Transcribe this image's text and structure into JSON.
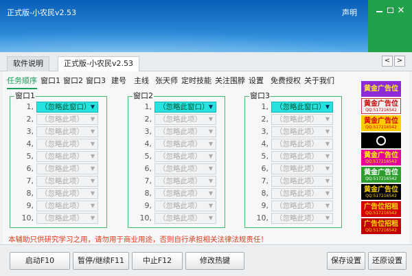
{
  "window": {
    "title": "正式版-小农民v2.53",
    "statement": "声明"
  },
  "top_tabs": [
    {
      "label": "软件说明"
    },
    {
      "label": "正式版-小农民v2.53"
    }
  ],
  "nav": {
    "prev": "<",
    "next": ">"
  },
  "sub_tabs": [
    {
      "label": "任务顺序"
    },
    {
      "label": "窗口1"
    },
    {
      "label": "窗口2"
    },
    {
      "label": "窗口3"
    },
    {
      "label": "建号"
    },
    {
      "label": "主线"
    },
    {
      "label": "张天师"
    },
    {
      "label": "定时技能"
    },
    {
      "label": "关注围脖"
    },
    {
      "label": "设置"
    },
    {
      "label": "免费授权"
    },
    {
      "label": "关于我们"
    }
  ],
  "groups": [
    {
      "title": "窗口1",
      "first": "（忽略此窗口）",
      "other": "（忽略此项）"
    },
    {
      "title": "窗口2",
      "first": "（忽略此窗口）",
      "other": "（忽略此项）"
    },
    {
      "title": "窗口3",
      "first": "（忽略此窗口）",
      "other": "（忽略此项）"
    }
  ],
  "row_numbers": [
    "1,",
    "2,",
    "3,",
    "4,",
    "5,",
    "6,",
    "7,",
    "8,",
    "9,",
    "10,"
  ],
  "warning": "本辅助只供研究学习之用，请勿用于商业用途，否则自行承担相关法律法规责任！",
  "ads": [
    {
      "text": "黄金广告位",
      "sub": ""
    },
    {
      "text": "黄金广告位",
      "sub": "QQ:517216542"
    },
    {
      "text": "黄金广告位",
      "sub": "QQ:517216542"
    },
    {
      "text": "",
      "sub": ""
    },
    {
      "text": "黄金广告位",
      "sub": "QQ:517216542"
    },
    {
      "text": "黄金广告位",
      "sub": "QQ:517216542"
    },
    {
      "text": "黄金广告位",
      "sub": "QQ:517216542"
    },
    {
      "text": "广告位招租",
      "sub": "QQ:517216542"
    },
    {
      "text": "广告位招租",
      "sub": "QQ:517216542"
    }
  ],
  "buttons": {
    "start": "启动F10",
    "pause": "暂停/继续F11",
    "stop": "中止F12",
    "hotkey": "修改热键",
    "save": "保存设置",
    "restore": "还原设置"
  }
}
